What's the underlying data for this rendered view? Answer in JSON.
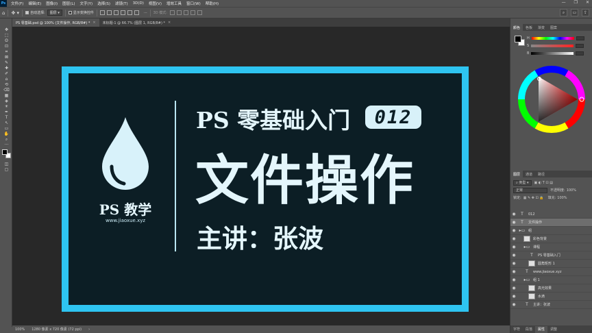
{
  "app": {
    "logo": "Ps"
  },
  "menu": [
    "文件(F)",
    "编辑(E)",
    "图像(I)",
    "图层(L)",
    "文字(Y)",
    "选择(S)",
    "滤镜(T)",
    "3D(D)",
    "视图(V)",
    "增效工具",
    "窗口(W)",
    "帮助(H)"
  ],
  "window_controls": {
    "minimize": "—",
    "restore": "❐",
    "close": "✕"
  },
  "options_bar": {
    "auto_select_label": "自动选择:",
    "auto_select_value": "图层",
    "show_transform_label": "显示变换控件",
    "mode_3d_label": "3D 模式:",
    "more_label": "···"
  },
  "tabs": [
    {
      "label": "PS 零基础.psd @ 100% (文件操作, RGB/8#) *",
      "active": true
    },
    {
      "label": "未标题-1 @ 66.7% (图层 1, RGB/8#) *",
      "active": false
    }
  ],
  "tools": [
    "✥",
    "⬚",
    "ʘ",
    "⊡",
    "⌗",
    "⊠",
    "✎",
    "✚",
    "✐",
    "⌂",
    "⟲",
    "⌫",
    "▦",
    "◈",
    "☀",
    "✒",
    "T",
    "↖",
    "▭",
    "✋",
    "⌕",
    "···"
  ],
  "artwork": {
    "logo_text": "PS 教学",
    "logo_url": "www.jiaoxue.xyz",
    "subtitle": "PS 零基础入门",
    "episode": "012",
    "title": "文件操作",
    "presenter": "主讲：张波",
    "border_color": "#2ec4f1",
    "bg_color": "#0c1e25",
    "text_color": "#e4f6fc"
  },
  "status": {
    "zoom": "100%",
    "doc_size": "1280 像素 x 720 像素 (72 ppi)",
    "arrow": "›"
  },
  "color_panel": {
    "tabs": [
      "颜色",
      "色板",
      "渐变",
      "图案"
    ],
    "sliders": [
      {
        "label": "H",
        "value": ""
      },
      {
        "label": "S",
        "value": ""
      },
      {
        "label": "B",
        "value": ""
      }
    ]
  },
  "layers_panel": {
    "tabs": [
      "图层",
      "通道",
      "路径"
    ],
    "filter_label": "类型",
    "blend_mode": "正常",
    "opacity_label": "不透明度:",
    "opacity_value": "100%",
    "lock_label": "锁定:",
    "fill_label": "填充:",
    "fill_value": "100%",
    "layers": [
      {
        "name": "012",
        "kind": "text",
        "indent": 0,
        "selected": false
      },
      {
        "name": "文件操作",
        "kind": "text",
        "indent": 0,
        "selected": true
      },
      {
        "name": "组",
        "kind": "folder",
        "indent": 0,
        "selected": false
      },
      {
        "name": "彩色背景",
        "kind": "image",
        "indent": 1,
        "selected": false
      },
      {
        "name": "课程",
        "kind": "folder",
        "indent": 1,
        "selected": false
      },
      {
        "name": "PS 零基础入门",
        "kind": "text",
        "indent": 2,
        "selected": false
      },
      {
        "name": "圆角矩形 1",
        "kind": "image",
        "indent": 2,
        "selected": false
      },
      {
        "name": "www.jiaoxue.xyz",
        "kind": "text",
        "indent": 1,
        "selected": false
      },
      {
        "name": "组 1",
        "kind": "folder",
        "indent": 1,
        "selected": false
      },
      {
        "name": "高光效果",
        "kind": "image",
        "indent": 2,
        "selected": false
      },
      {
        "name": "水滴",
        "kind": "image",
        "indent": 2,
        "selected": false
      },
      {
        "name": "主讲：张波",
        "kind": "text",
        "indent": 1,
        "selected": false
      }
    ],
    "bottom_icons": [
      "⊝",
      "fx",
      "◐",
      "▣",
      "⊞",
      "🗑"
    ]
  },
  "bottom_tabs": [
    "字符",
    "段落",
    "属性",
    "调整"
  ]
}
